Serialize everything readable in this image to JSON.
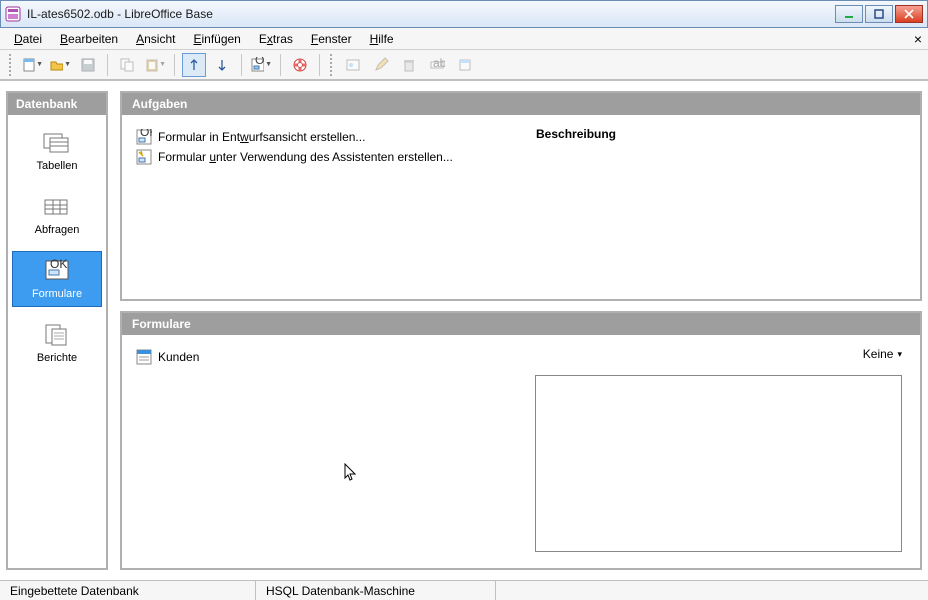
{
  "window": {
    "title": "IL-ates6502.odb - LibreOffice Base"
  },
  "menu": {
    "file": "Datei",
    "file_u": "D",
    "edit": "Bearbeiten",
    "edit_u": "B",
    "view": "Ansicht",
    "view_u": "A",
    "insert": "Einfügen",
    "insert_u": "E",
    "tools": "Extras",
    "tools_u": "x",
    "window": "Fenster",
    "window_u": "F",
    "help": "Hilfe",
    "help_u": "H"
  },
  "sidebar": {
    "header": "Datenbank",
    "items": [
      {
        "label": "Tabellen"
      },
      {
        "label": "Abfragen"
      },
      {
        "label": "Formulare"
      },
      {
        "label": "Berichte"
      }
    ],
    "active_index": 2
  },
  "tasks": {
    "header": "Aufgaben",
    "items": [
      {
        "label_pre": "Formular in Ent",
        "u": "w",
        "label_post": "urfsansicht erstellen..."
      },
      {
        "label_pre": "Formular ",
        "u": "u",
        "label_post": "nter Verwendung des Assistenten erstellen..."
      }
    ],
    "description_header": "Beschreibung"
  },
  "objects": {
    "header": "Formulare",
    "items": [
      {
        "label": "Kunden"
      }
    ],
    "view_mode": "Keine"
  },
  "status": {
    "left": "Eingebettete Datenbank",
    "right": "HSQL Datenbank-Maschine"
  }
}
